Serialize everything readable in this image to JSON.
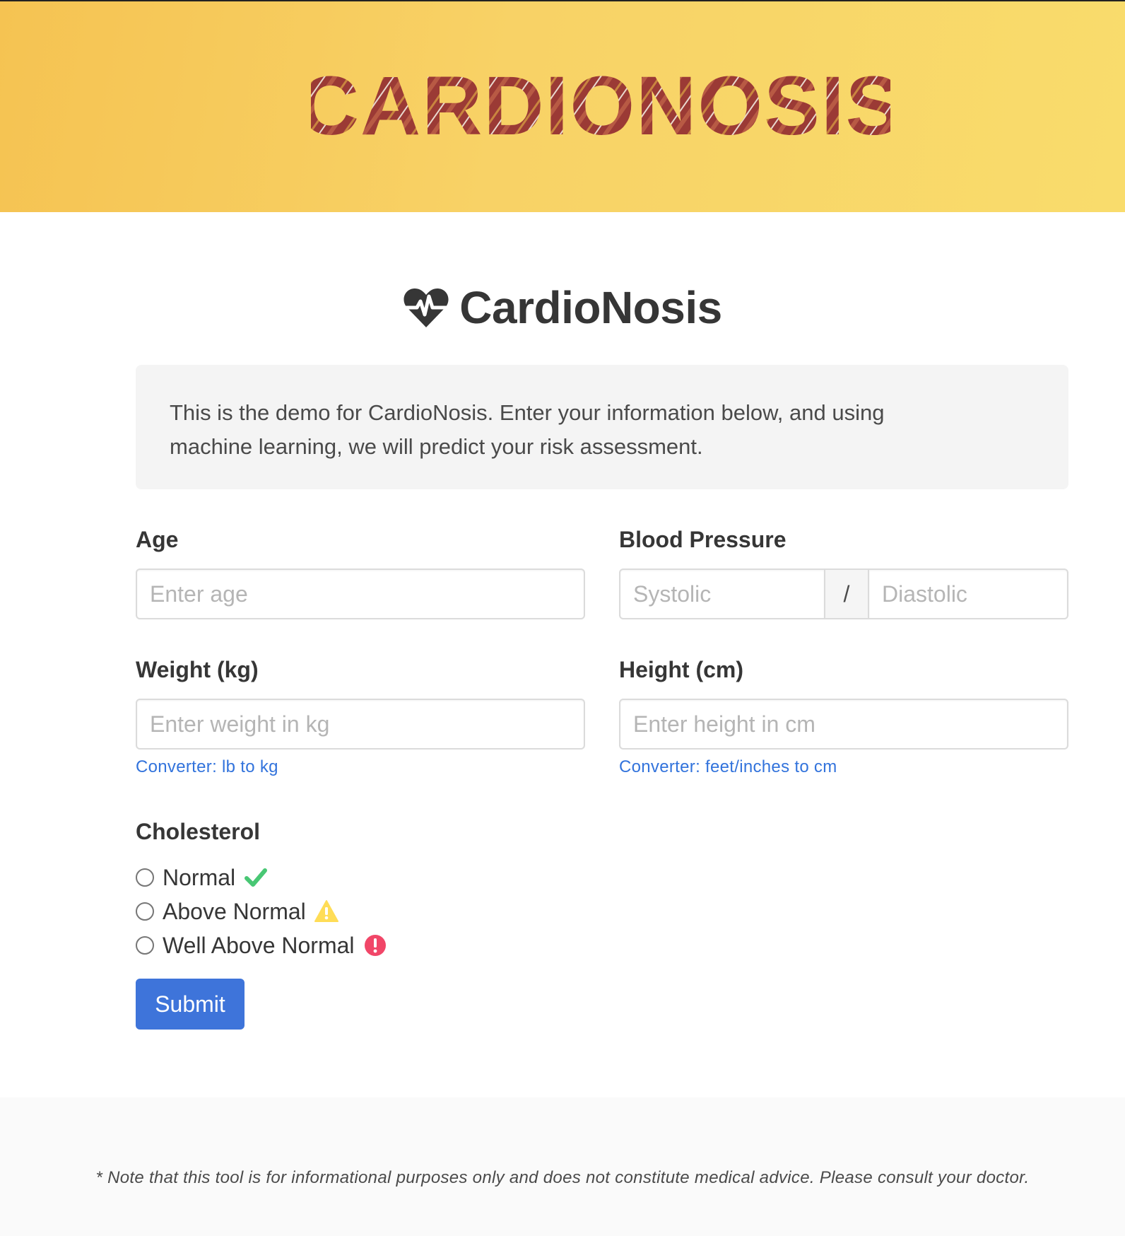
{
  "header": {
    "logo_text": "CARDIONOSIS",
    "colors": {
      "banner": "#f8d266",
      "logo": "#9b3a35"
    }
  },
  "page": {
    "title": "CardioNosis",
    "title_icon": "heartbeat-icon"
  },
  "intro": {
    "text": "This is the demo for CardioNosis. Enter your information below, and using machine learning, we will predict your risk assessment."
  },
  "form": {
    "age": {
      "label": "Age",
      "placeholder": "Enter age",
      "value": ""
    },
    "blood_pressure": {
      "label": "Blood Pressure",
      "systolic_placeholder": "Systolic",
      "separator": "/",
      "diastolic_placeholder": "Diastolic"
    },
    "weight": {
      "label": "Weight (kg)",
      "placeholder": "Enter weight in kg",
      "help": "Converter: lb to kg"
    },
    "height": {
      "label": "Height (cm)",
      "placeholder": "Enter height in cm",
      "help": "Converter: feet/inches to cm"
    },
    "cholesterol": {
      "label": "Cholesterol",
      "options": [
        {
          "label": "Normal",
          "icon": "check-icon",
          "color": "#48c774"
        },
        {
          "label": "Above Normal",
          "icon": "warning-icon",
          "color": "#ffdd57"
        },
        {
          "label": "Well Above Normal",
          "icon": "exclamation-circle-icon",
          "color": "#f14668"
        }
      ]
    },
    "submit_label": "Submit",
    "submit_color": "#3e74da"
  },
  "footer": {
    "note": "* Note that this tool is for informational purposes only and does not constitute medical advice. Please consult your doctor."
  }
}
